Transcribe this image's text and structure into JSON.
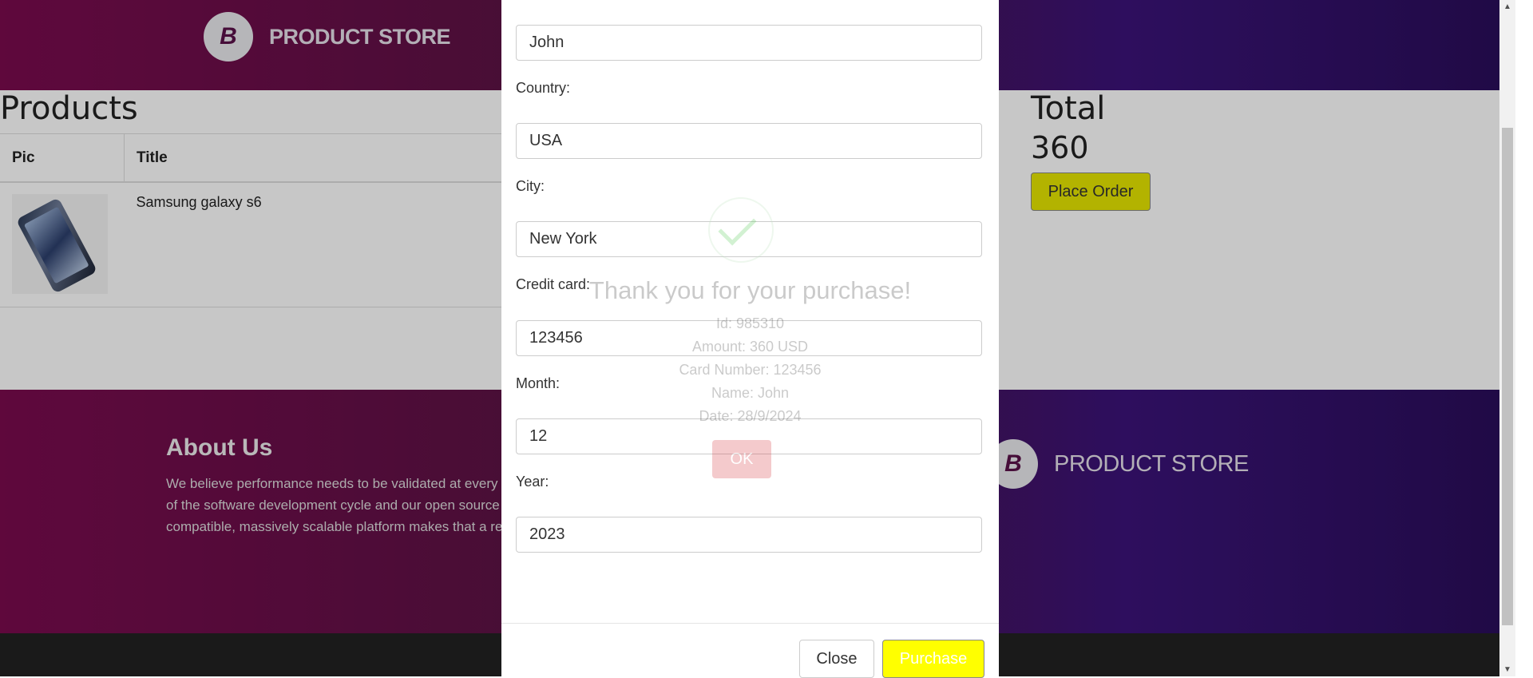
{
  "header": {
    "brand": "PRODUCT STORE",
    "logo_letter": "B"
  },
  "products": {
    "title": "Products",
    "columns": [
      "Pic",
      "Title"
    ],
    "rows": [
      {
        "title": "Samsung galaxy s6"
      }
    ]
  },
  "total": {
    "label": "Total",
    "value": "360",
    "place_order": "Place Order"
  },
  "footer": {
    "about_title": "About Us",
    "about_text": "We believe performance needs to be validated at every stage of the software development cycle and our open source compatible, massively scalable platform makes that a reality.",
    "brand": "PRODUCT STORE",
    "logo_letter": "B"
  },
  "form": {
    "name_value": "John",
    "country_label": "Country:",
    "country_value": "USA",
    "city_label": "City:",
    "city_value": "New York",
    "card_label": "Credit card:",
    "card_value": "123456",
    "month_label": "Month:",
    "month_value": "12",
    "year_label": "Year:",
    "year_value": "2023",
    "close_label": "Close",
    "purchase_label": "Purchase"
  },
  "success": {
    "title": "Thank you for your purchase!",
    "id": "Id: 985310",
    "amount": "Amount: 360 USD",
    "card": "Card Number: 123456",
    "name": "Name: John",
    "date": "Date: 28/9/2024",
    "ok": "OK"
  },
  "colors": {
    "purchase_button": "#ffff00",
    "place_order": "#e6e600",
    "ok_button": "#d9444a"
  }
}
